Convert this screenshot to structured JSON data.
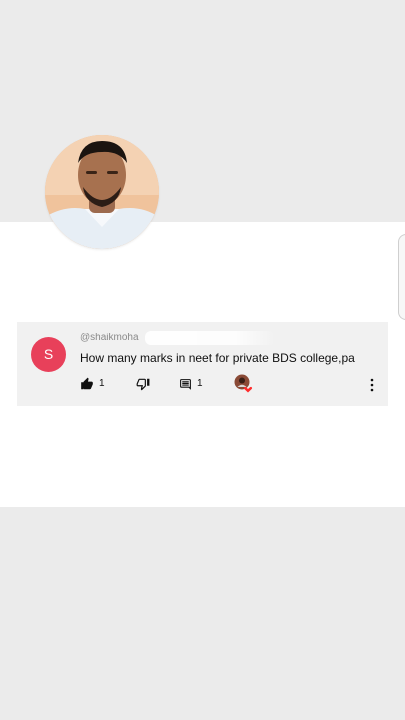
{
  "comment": {
    "avatar_letter": "S",
    "avatar_color": "#e8405a",
    "handle": "@shaikmoha",
    "text": "How many marks in neet for private BDS college,pa",
    "like_count": "1",
    "reply_count": "1",
    "icons": {
      "like": "thumb-up-icon",
      "dislike": "thumb-down-icon",
      "reply": "comment-icon",
      "creator_heart": "creator-heart-icon",
      "more": "more-vert-icon"
    }
  }
}
